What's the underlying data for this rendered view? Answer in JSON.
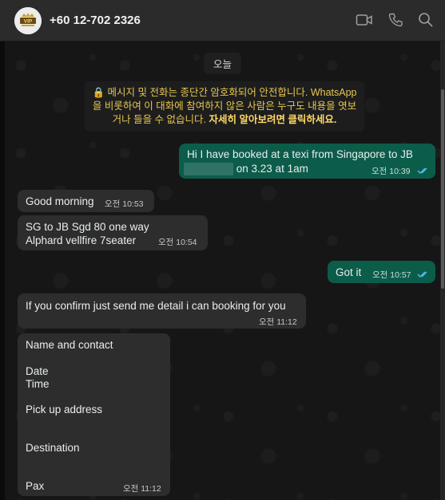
{
  "header": {
    "contact_name": "+60 12-702 2326",
    "avatar_text": "VIP",
    "icons": [
      "video-call-icon",
      "voice-call-icon",
      "search-icon"
    ]
  },
  "chat": {
    "day_chip": "오늘",
    "system_note": {
      "text": "메시지 및 전화는 종단간 암호화되어 안전합니다. WhatsApp을 비롯하여 이 대화에 참여하지 않은 사람은 누구도 내용을 엿보거나 들을 수 없습니다.",
      "link": "자세히 알아보려면 클릭하세요."
    },
    "messages": [
      {
        "direction": "out",
        "lines": [
          "Hi I have booked at a texi from Singapore to JB",
          "on 3.23 at 1am"
        ],
        "time": "오전 10:39",
        "read": true
      },
      {
        "direction": "in",
        "lines": [
          "Good morning"
        ],
        "time": "오전 10:53"
      },
      {
        "direction": "in",
        "lines": [
          "SG to JB Sgd 80 one way",
          "Alphard vellfire 7seater"
        ],
        "time": "오전 10:54"
      },
      {
        "direction": "out",
        "lines": [
          "Got it"
        ],
        "time": "오전 10:57",
        "read": true
      },
      {
        "direction": "in",
        "lines": [
          "If you confirm just send me detail i can booking for you"
        ],
        "time": "오전 11:12"
      },
      {
        "direction": "in",
        "lines": [
          "Name and contact",
          "Date",
          "Time",
          "Pick up address",
          "Destination",
          "Pax"
        ],
        "time": "오전 11:12"
      }
    ]
  },
  "colors": {
    "header_bg": "#2b2b2b",
    "chat_bg": "#161616",
    "incoming_bubble": "#2d2d2d",
    "outgoing_bubble": "#0c5c4a",
    "read_ticks": "#53bdeb",
    "system_note_text": "#e7c64f"
  }
}
